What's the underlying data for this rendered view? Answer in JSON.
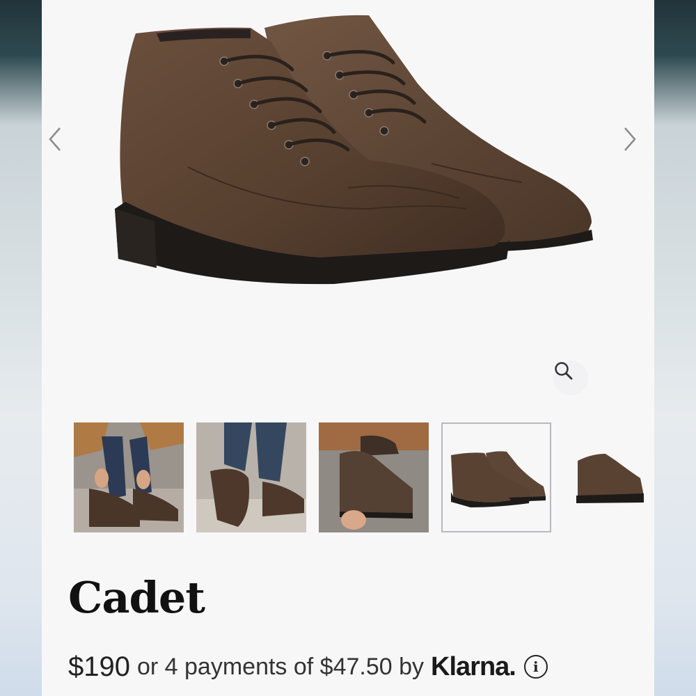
{
  "product": {
    "name": "Cadet",
    "price": "$190",
    "installment_text": "or 4 payments of $47.50 by",
    "provider": "Klarna.",
    "info_symbol": "i"
  },
  "gallery": {
    "thumbnail_count": 5,
    "selected_index": 3,
    "icons": [
      "chevron-left-icon",
      "chevron-right-icon",
      "zoom-icon",
      "info-icon"
    ]
  },
  "colors": {
    "leather": "#5a4233",
    "sole": "#1e1a18",
    "background": "#f7f7f8",
    "selected_border": "#b8b8bd"
  }
}
